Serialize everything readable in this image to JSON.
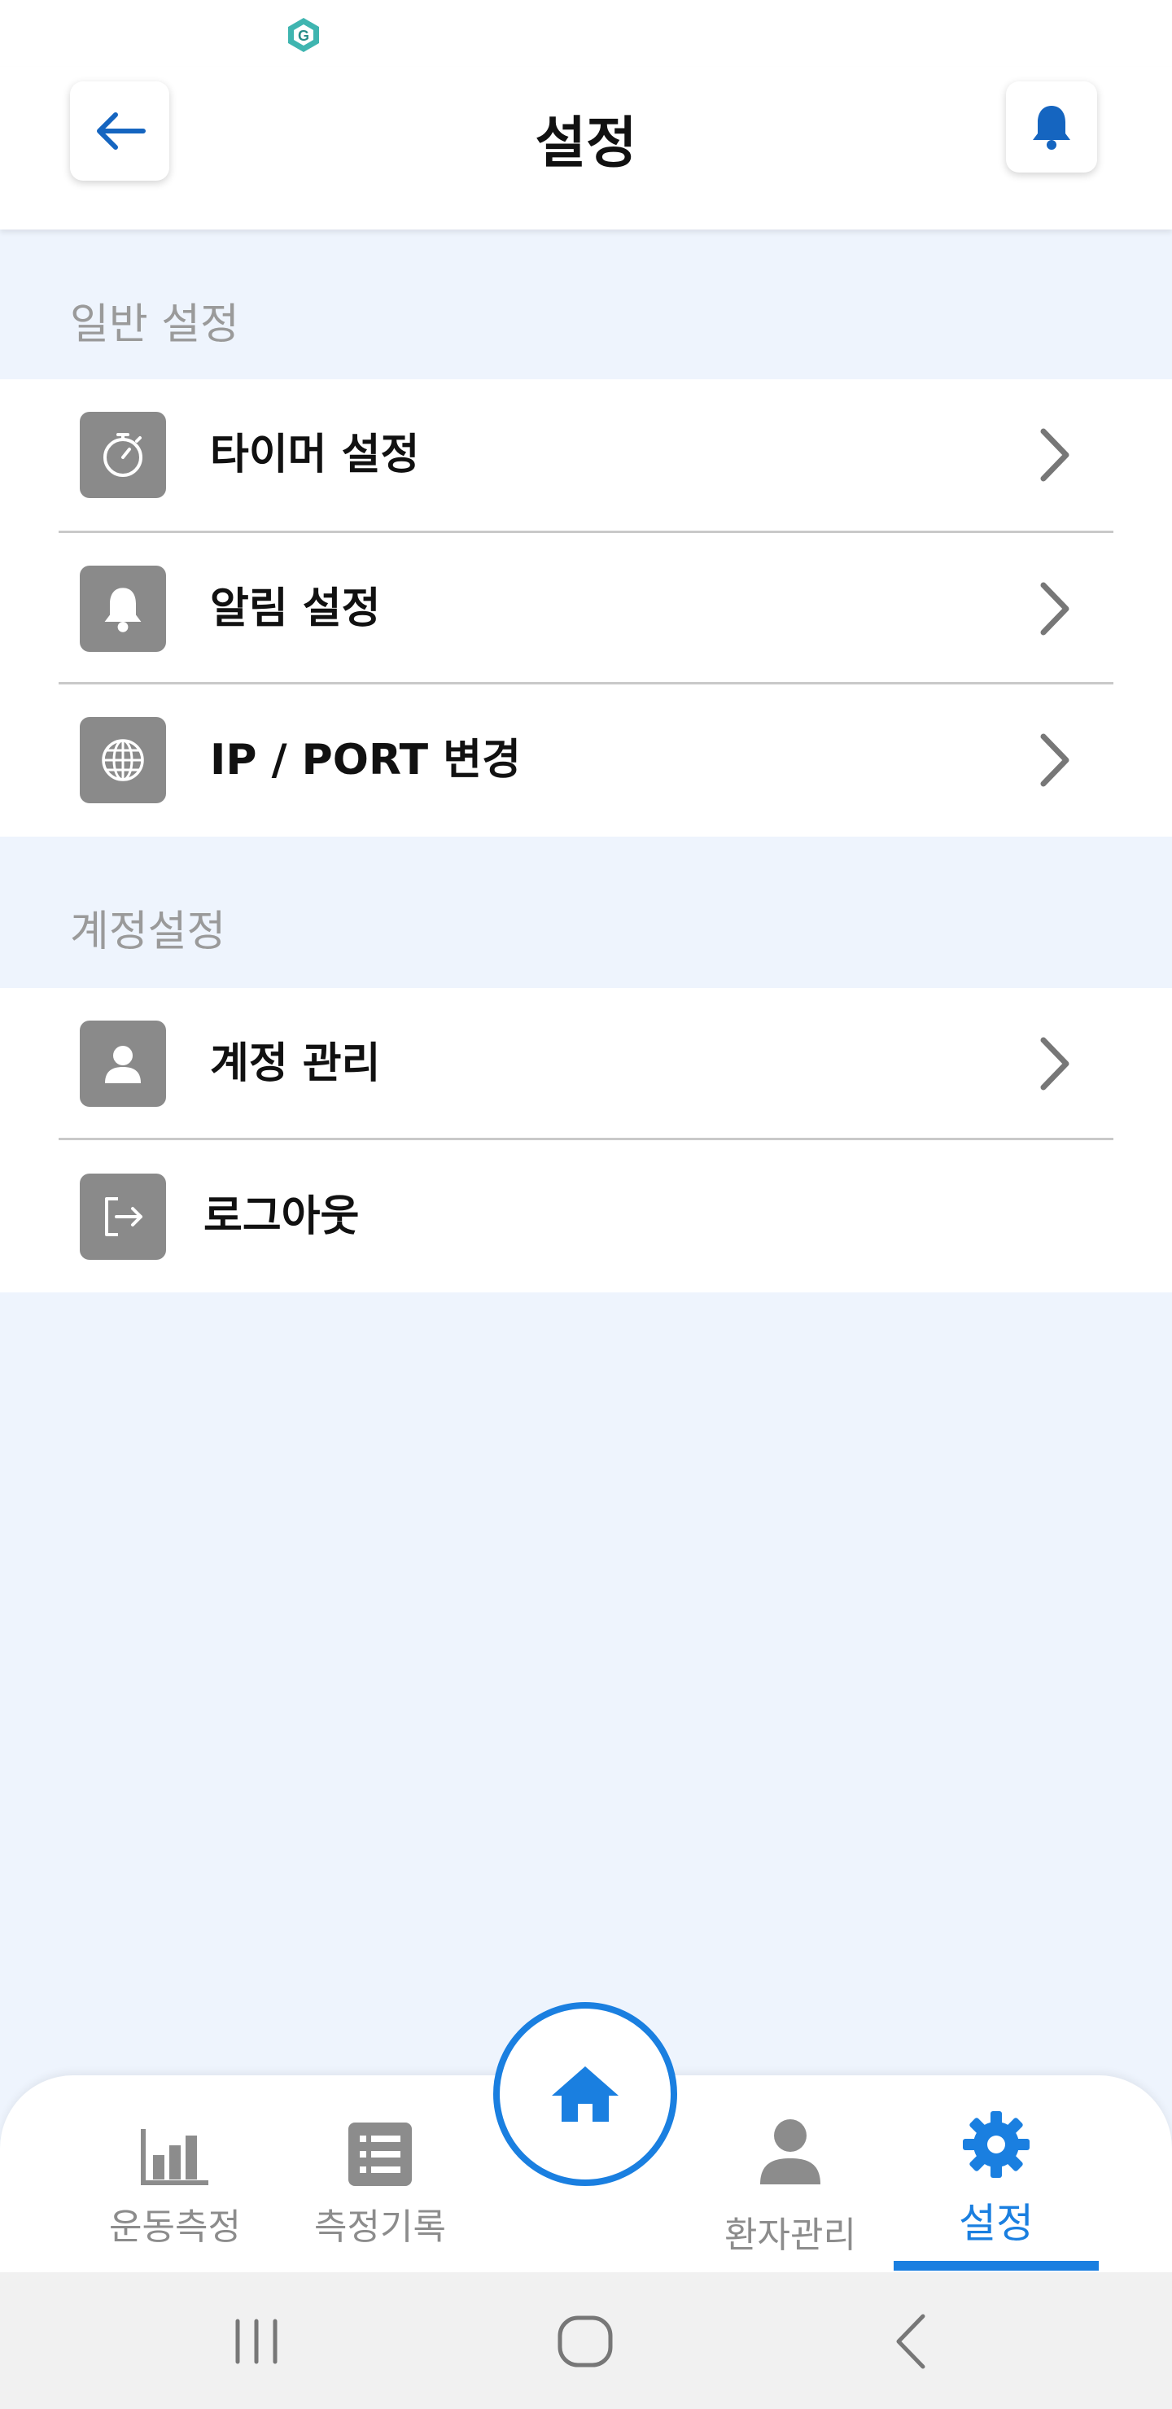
{
  "header": {
    "title": "설정"
  },
  "sections": [
    {
      "header": "일반 설정",
      "items": [
        {
          "label": "타이머 설정",
          "icon": "stopwatch-icon"
        },
        {
          "label": "알림 설정",
          "icon": "bell-icon"
        },
        {
          "label": "IP / PORT 변경",
          "icon": "globe-icon"
        }
      ]
    },
    {
      "header": "계정설정",
      "items": [
        {
          "label": "계정 관리",
          "icon": "person-icon"
        },
        {
          "label": "로그아웃",
          "icon": "logout-icon"
        }
      ]
    }
  ],
  "bottom_nav": {
    "items": [
      {
        "label": "운동측정",
        "icon": "bar-chart-icon"
      },
      {
        "label": "측정기록",
        "icon": "list-icon"
      },
      {
        "label": "환자관리",
        "icon": "person-icon"
      },
      {
        "label": "설정",
        "icon": "gear-icon"
      }
    ],
    "home_icon": "home-icon",
    "active": "설정"
  },
  "colors": {
    "accent": "#1a7fe0",
    "page_background": "#eef4fd",
    "icon_box": "#8a8a8a",
    "section_header_text": "#9a9a9a"
  }
}
